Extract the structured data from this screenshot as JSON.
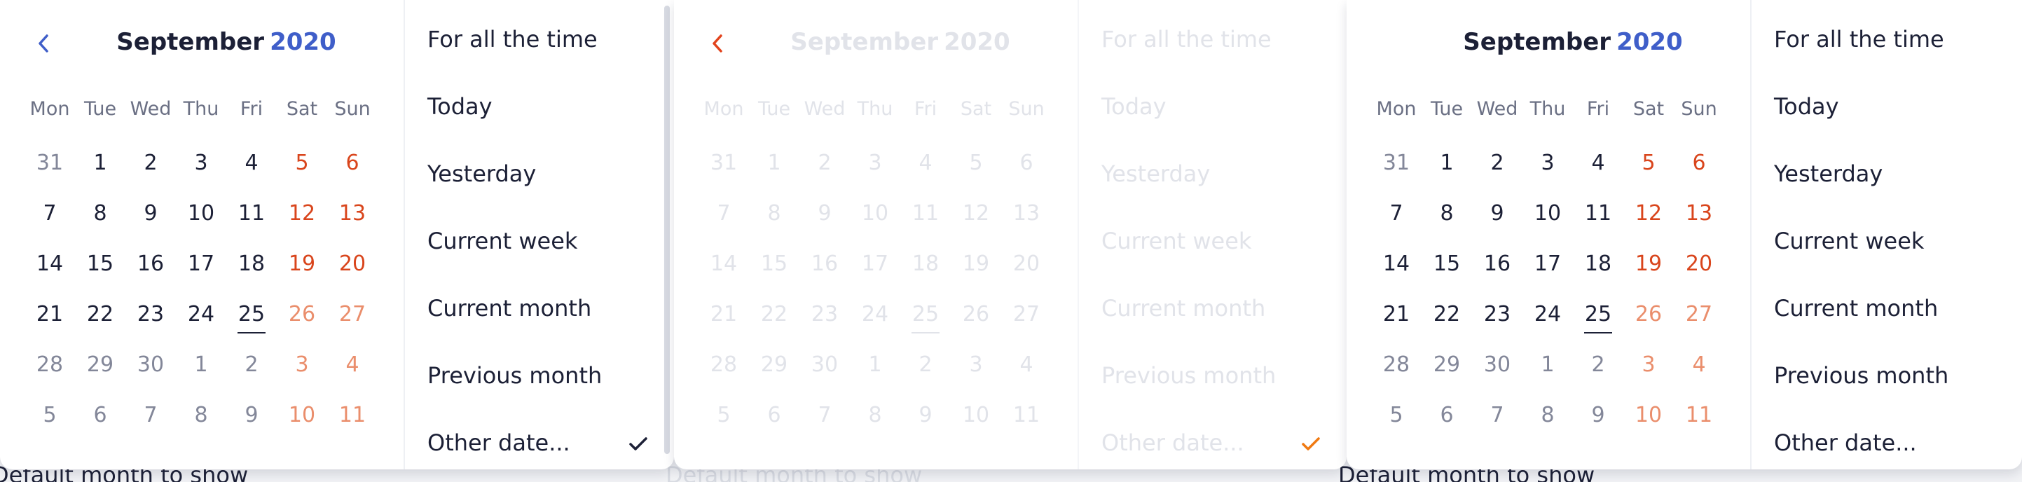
{
  "hint_text": "Default month to show",
  "month": "September",
  "year": "2020",
  "weekdays": [
    "Mon",
    "Tue",
    "Wed",
    "Thu",
    "Fri",
    "Sat",
    "Sun"
  ],
  "weeks": [
    [
      {
        "d": "31",
        "o": true
      },
      {
        "d": "1"
      },
      {
        "d": "2"
      },
      {
        "d": "3"
      },
      {
        "d": "4"
      },
      {
        "d": "5"
      },
      {
        "d": "6"
      }
    ],
    [
      {
        "d": "7"
      },
      {
        "d": "8"
      },
      {
        "d": "9"
      },
      {
        "d": "10"
      },
      {
        "d": "11"
      },
      {
        "d": "12"
      },
      {
        "d": "13"
      }
    ],
    [
      {
        "d": "14"
      },
      {
        "d": "15"
      },
      {
        "d": "16"
      },
      {
        "d": "17"
      },
      {
        "d": "18"
      },
      {
        "d": "19"
      },
      {
        "d": "20"
      }
    ],
    [
      {
        "d": "21"
      },
      {
        "d": "22"
      },
      {
        "d": "23"
      },
      {
        "d": "24"
      },
      {
        "d": "25",
        "t": true
      },
      {
        "d": "26",
        "o": true
      },
      {
        "d": "27",
        "o": true
      }
    ],
    [
      {
        "d": "28",
        "o": true
      },
      {
        "d": "29",
        "o": true
      },
      {
        "d": "30",
        "o": true
      },
      {
        "d": "1",
        "o": true
      },
      {
        "d": "2",
        "o": true
      },
      {
        "d": "3",
        "o": true
      },
      {
        "d": "4",
        "o": true
      }
    ],
    [
      {
        "d": "5",
        "o": true
      },
      {
        "d": "6",
        "o": true
      },
      {
        "d": "7",
        "o": true
      },
      {
        "d": "8",
        "o": true
      },
      {
        "d": "9",
        "o": true
      },
      {
        "d": "10",
        "o": true
      },
      {
        "d": "11",
        "o": true
      }
    ]
  ],
  "options": [
    "For all the time",
    "Today",
    "Yesterday",
    "Current week",
    "Current month",
    "Previous month",
    "Other date..."
  ],
  "widgets": [
    {
      "state": "normal",
      "selected_option": 6,
      "check_color": "#1c2036",
      "prev_arrow_color": "#3f5ec9",
      "scrollbar": true
    },
    {
      "state": "disabled",
      "selected_option": 6,
      "check_color": "#f07a12",
      "prev_arrow_color": "#e2431c",
      "scrollbar": false
    },
    {
      "state": "normal",
      "selected_option": null,
      "check_color": "#1c2036",
      "prev_arrow_color": null,
      "scrollbar": false
    }
  ],
  "colors": {
    "text": "#1c2036",
    "year": "#3f5ec9",
    "weekend": "#d9451c",
    "weekend_other": "#ea8e6c",
    "other_day": "#838799",
    "weekday_header": "#6b7084"
  }
}
